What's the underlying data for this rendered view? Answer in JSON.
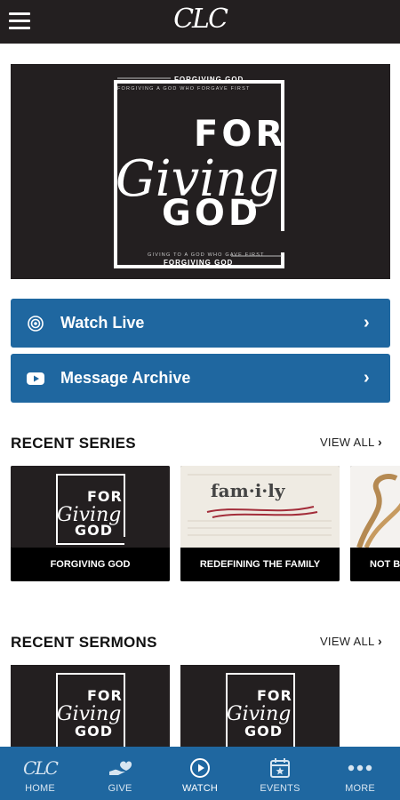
{
  "header": {
    "logo_text": "CLC",
    "menu_icon": "hamburger-icon"
  },
  "hero": {
    "top_title": "FORGIVING GOD",
    "top_subtitle": "FORGIVING A GOD WHO FORGAVE FIRST",
    "line1": "FOR",
    "script": "Giving",
    "line3": "GOD",
    "bottom_subtitle": "GIVING TO A GOD WHO GAVE FIRST",
    "bottom_title": "FORGIVING GOD"
  },
  "actions": [
    {
      "label": "Watch Live",
      "icon": "broadcast-icon"
    },
    {
      "label": "Message Archive",
      "icon": "play-video-icon"
    }
  ],
  "recent_series": {
    "title": "RECENT SERIES",
    "view_all": "VIEW ALL",
    "items": [
      {
        "caption": "FORGIVING GOD"
      },
      {
        "caption": "REDEFINING THE FAMILY",
        "art_title": "fam·i·ly"
      },
      {
        "caption": "NOT B"
      }
    ]
  },
  "recent_sermons": {
    "title": "RECENT SERMONS",
    "view_all": "VIEW ALL"
  },
  "bottom_nav": [
    {
      "label": "HOME",
      "icon": "clc-logo-icon",
      "active": false
    },
    {
      "label": "GIVE",
      "icon": "heart-hand-icon",
      "active": false
    },
    {
      "label": "WATCH",
      "icon": "play-circle-icon",
      "active": true
    },
    {
      "label": "EVENTS",
      "icon": "calendar-icon",
      "active": false
    },
    {
      "label": "MORE",
      "icon": "more-dots-icon",
      "active": false
    }
  ],
  "colors": {
    "topbar": "#231f20",
    "accent": "#1f67a0",
    "artwork_bg": "#231f20"
  }
}
